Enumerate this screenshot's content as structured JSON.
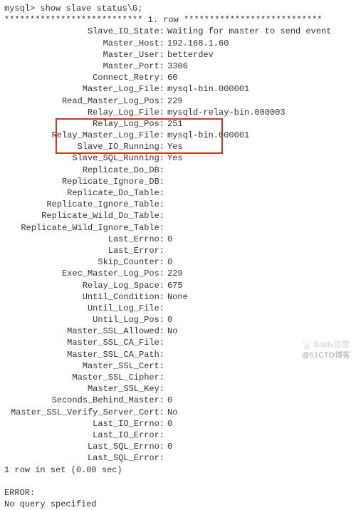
{
  "prompt": "mysql> show slave status\\G;",
  "row_header": "*************************** 1. row ***************************",
  "fields": [
    {
      "label": "Slave_IO_State",
      "value": "Waiting for master to send event"
    },
    {
      "label": "Master_Host",
      "value": "192.168.1.60"
    },
    {
      "label": "Master_User",
      "value": "betterdev"
    },
    {
      "label": "Master_Port",
      "value": "3306"
    },
    {
      "label": "Connect_Retry",
      "value": "60"
    },
    {
      "label": "Master_Log_File",
      "value": "mysql-bin.000001"
    },
    {
      "label": "Read_Master_Log_Pos",
      "value": "229"
    },
    {
      "label": "Relay_Log_File",
      "value": "mysqld-relay-bin.000003"
    },
    {
      "label": "Relay_Log_Pos",
      "value": "251"
    },
    {
      "label": "Relay_Master_Log_File",
      "value": "mysql-bin.000001"
    },
    {
      "label": "Slave_IO_Running",
      "value": "Yes"
    },
    {
      "label": "Slave_SQL_Running",
      "value": "Yes"
    },
    {
      "label": "Replicate_Do_DB",
      "value": ""
    },
    {
      "label": "Replicate_Ignore_DB",
      "value": ""
    },
    {
      "label": "Replicate_Do_Table",
      "value": ""
    },
    {
      "label": "Replicate_Ignore_Table",
      "value": ""
    },
    {
      "label": "Replicate_Wild_Do_Table",
      "value": ""
    },
    {
      "label": "Replicate_Wild_Ignore_Table",
      "value": ""
    },
    {
      "label": "Last_Errno",
      "value": "0"
    },
    {
      "label": "Last_Error",
      "value": ""
    },
    {
      "label": "Skip_Counter",
      "value": "0"
    },
    {
      "label": "Exec_Master_Log_Pos",
      "value": "229"
    },
    {
      "label": "Relay_Log_Space",
      "value": "675"
    },
    {
      "label": "Until_Condition",
      "value": "None"
    },
    {
      "label": "Until_Log_File",
      "value": ""
    },
    {
      "label": "Until_Log_Pos",
      "value": "0"
    },
    {
      "label": "Master_SSL_Allowed",
      "value": "No"
    },
    {
      "label": "Master_SSL_CA_File",
      "value": ""
    },
    {
      "label": "Master_SSL_CA_Path",
      "value": ""
    },
    {
      "label": "Master_SSL_Cert",
      "value": ""
    },
    {
      "label": "Master_SSL_Cipher",
      "value": ""
    },
    {
      "label": "Master_SSL_Key",
      "value": ""
    },
    {
      "label": "Seconds_Behind_Master",
      "value": "0"
    },
    {
      "label": "Master_SSL_Verify_Server_Cert",
      "value": "No"
    },
    {
      "label": "Last_IO_Errno",
      "value": "0"
    },
    {
      "label": "Last_IO_Error",
      "value": ""
    },
    {
      "label": "Last_SQL_Errno",
      "value": "0"
    },
    {
      "label": "Last_SQL_Error",
      "value": ""
    }
  ],
  "footer_row": "1 row in set (0.00 sec)",
  "error_label": "ERROR:",
  "error_msg": "No query specified",
  "watermark": {
    "brand": "Baidu百度",
    "credit": "@51CTO博客"
  }
}
